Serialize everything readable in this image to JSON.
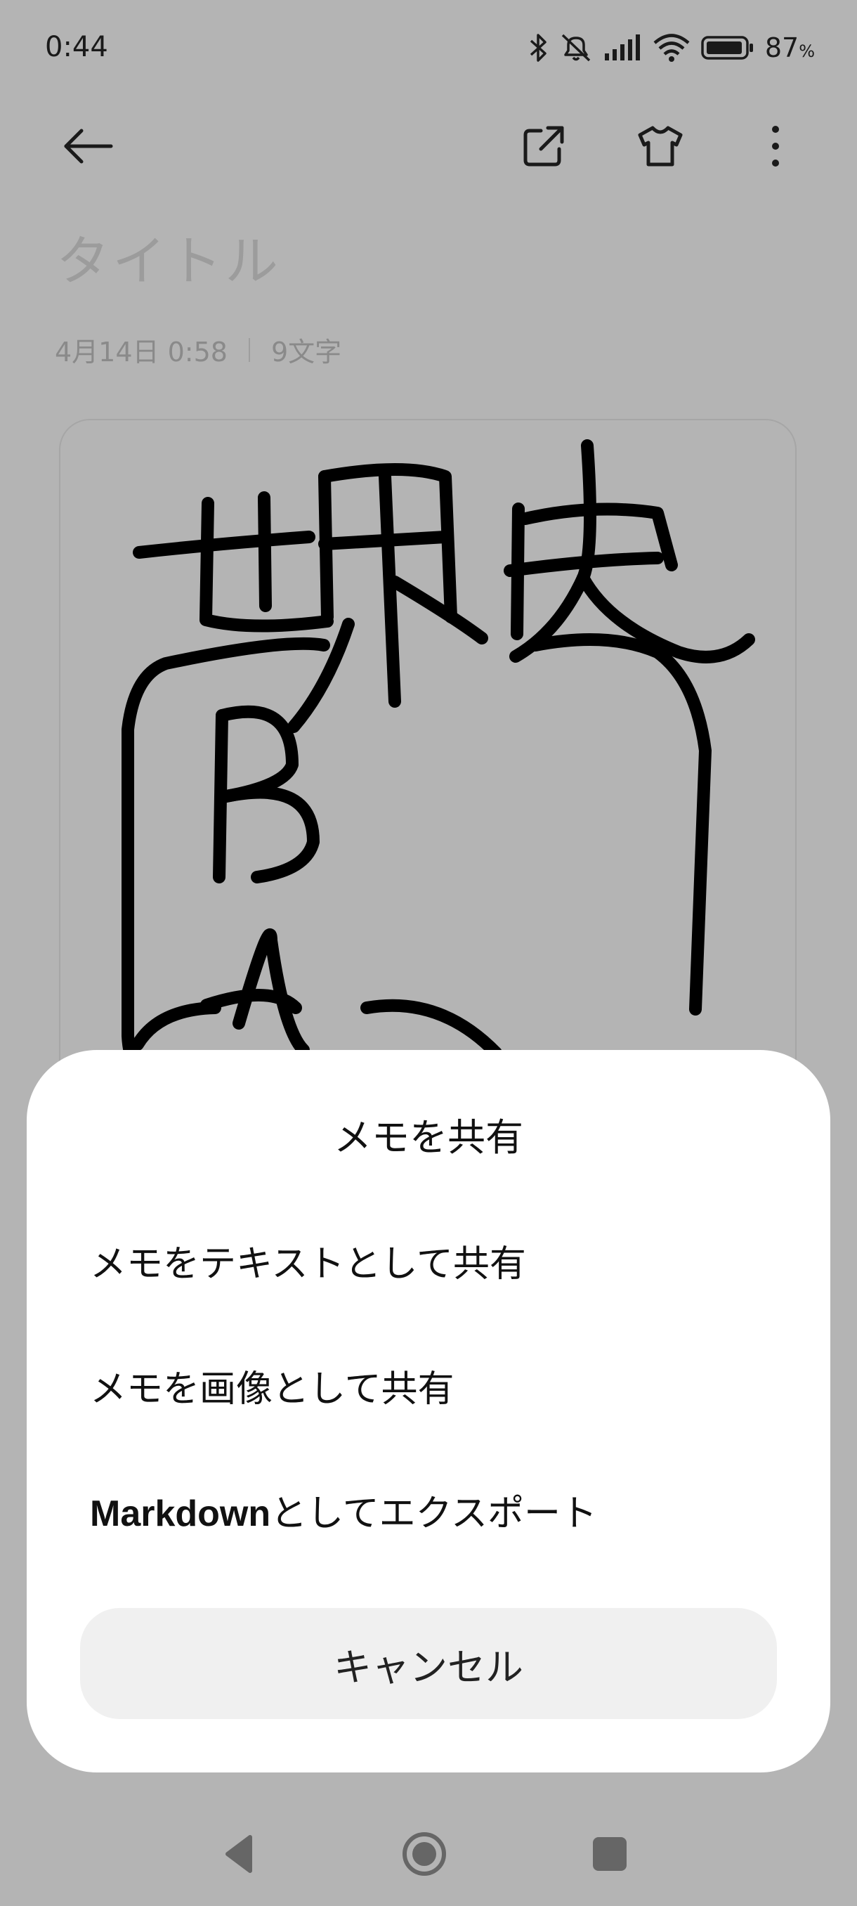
{
  "status_bar": {
    "time": "0:44",
    "battery_percent": "87",
    "percent_sign": "%",
    "icons": [
      "bluetooth-icon",
      "muted-bell-icon",
      "cell-signal-icon",
      "wifi-icon",
      "battery-icon"
    ]
  },
  "toolbar": {
    "icons": [
      "back-arrow-icon",
      "share-external-icon",
      "theme-shirt-icon",
      "more-vertical-icon"
    ]
  },
  "note": {
    "title_placeholder": "タイトル",
    "date": "4月14日 0:58",
    "char_count": "9文字"
  },
  "share_sheet": {
    "title": "メモを共有",
    "option_text": "メモをテキストとして共有",
    "option_image": "メモを画像として共有",
    "option_markdown_bold": "Markdown",
    "option_markdown_rest": "としてエクスポート",
    "cancel": "キャンセル"
  },
  "nav_bar": {
    "icons": [
      "nav-back-icon",
      "nav-home-icon",
      "nav-recents-icon"
    ]
  },
  "colors": {
    "scrim": "#b4b4b4",
    "sheet_bg": "#ffffff",
    "cancel_bg": "#f0f0f0"
  }
}
